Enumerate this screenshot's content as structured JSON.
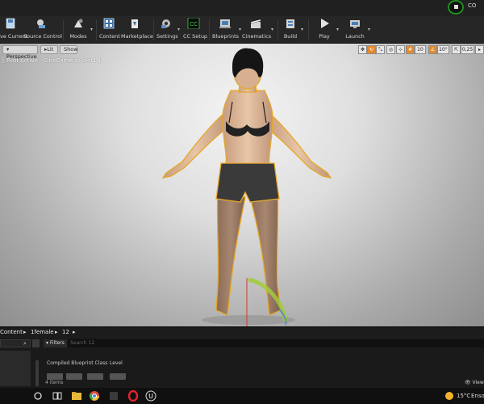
{
  "titlebar": {
    "corner_text": "CO"
  },
  "toolbar": {
    "items": [
      {
        "label": "ve Current",
        "icon": "save-icon"
      },
      {
        "label": "Source Control",
        "icon": "source-control-icon"
      },
      {
        "label": "Modes",
        "icon": "modes-icon"
      },
      {
        "label": "Content",
        "icon": "content-icon"
      },
      {
        "label": "Marketplace",
        "icon": "marketplace-icon"
      },
      {
        "label": "Settings",
        "icon": "settings-icon"
      },
      {
        "label": "CC Setup",
        "icon": "cc-setup-icon"
      },
      {
        "label": "Blueprints",
        "icon": "blueprints-icon"
      },
      {
        "label": "Cinematics",
        "icon": "cinematics-icon"
      },
      {
        "label": "Build",
        "icon": "build-icon"
      },
      {
        "label": "Play",
        "icon": "play-icon"
      },
      {
        "label": "Launch",
        "icon": "launch-icon"
      }
    ]
  },
  "viewport": {
    "perspective_label": "Perspective",
    "lit_label": "Lit",
    "show_label": "Show",
    "pilot_text": "[ Pilot Active - CineCameraActor1 ]",
    "grid_snap": "10",
    "rotation_snap": "10°",
    "scale_snap": "0,25",
    "camera_speed": "4"
  },
  "content_browser": {
    "path_root": "Content",
    "path_1": "1female",
    "path_2": "12",
    "filters_label": "Filters",
    "search_placeholder": "Search 12",
    "col_1": "Compiled Blueprint Class",
    "col_2": "Level",
    "item_count": "4 items",
    "view_options": "View"
  },
  "taskbar": {
    "temperature": "15°C",
    "weather_text": "Enso"
  },
  "colors": {
    "accent_orange": "#e48a2e",
    "toolbar_bg": "#262626",
    "selection_outline": "#e6a82a"
  }
}
